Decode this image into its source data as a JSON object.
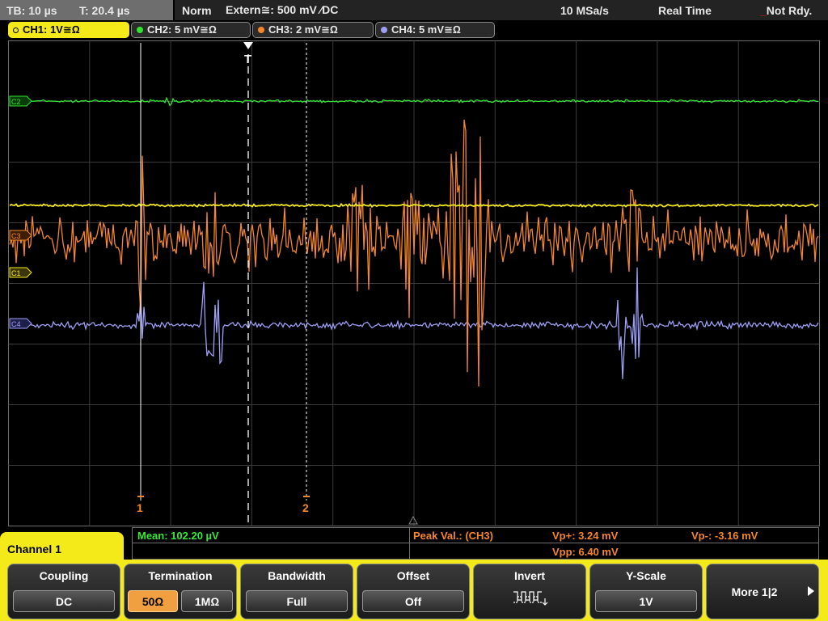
{
  "status_bar": {
    "timebase": "TB: 10 µs",
    "trigger_pos": "T: 20.4 µs",
    "trigger_mode": "Norm",
    "trigger_source": "Extern≅: 500 mV ∕DC",
    "sample_rate": "10 MSa/s",
    "acq_mode": "Real Time",
    "run_status": "Not Rdy."
  },
  "channel_tabs": [
    {
      "label": "CH1: 1V≅Ω",
      "color": "#f4ea1a",
      "active": true
    },
    {
      "label": "CH2: 5 mV≅Ω",
      "color": "#2ee62e",
      "active": false
    },
    {
      "label": "CH3: 2 mV≅Ω",
      "color": "#f5862a",
      "active": false
    },
    {
      "label": "CH4: 5 mV≅Ω",
      "color": "#9e9ef5",
      "active": false
    }
  ],
  "trace_markers": {
    "ch2": "C2",
    "ch3": "C3",
    "ch1": "C1",
    "ch4": "C4",
    "trigger": "T"
  },
  "cursors": {
    "cursor1_label": "1",
    "cursor2_label": "2"
  },
  "measurements": {
    "mean": "Mean: 102.20 µV",
    "peak_label": "Peak Val.:  (CH3)",
    "vp_plus": "Vp+: 3.24 mV",
    "vp_minus": "Vp-: -3.16 mV",
    "vpp": "Vpp: 6.40 mV"
  },
  "menu": {
    "title": "Channel 1",
    "softkeys": [
      {
        "title": "Coupling",
        "values": [
          "DC"
        ]
      },
      {
        "title": "Termination",
        "values": [
          "50Ω",
          "1MΩ"
        ],
        "selected": 0
      },
      {
        "title": "Bandwidth",
        "values": [
          "Full"
        ]
      },
      {
        "title": "Offset",
        "values": [
          "Off"
        ]
      },
      {
        "title": "Invert",
        "icon": "square-wave-invert-icon"
      },
      {
        "title": "Y-Scale",
        "values": [
          "1V"
        ]
      },
      {
        "title": "More 1|2",
        "icon": "arrow-right-icon"
      }
    ]
  },
  "colors": {
    "ch1": "#f4ea1a",
    "ch2": "#2ee62e",
    "ch3": "#f5862a",
    "ch4": "#9e9ef5",
    "measure_green": "#38e838",
    "measure_orange": "#f5862a"
  }
}
